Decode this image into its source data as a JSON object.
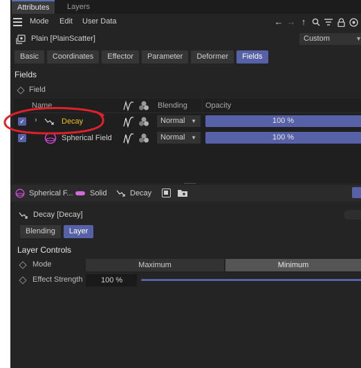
{
  "tabs": {
    "attributes": "Attributes",
    "layers": "Layers"
  },
  "menu": {
    "mode": "Mode",
    "edit": "Edit",
    "user_data": "User Data"
  },
  "object": {
    "title": "Plain [PlainScatter]",
    "preset": "Custom"
  },
  "prop_tabs": [
    "Basic",
    "Coordinates",
    "Effector",
    "Parameter",
    "Deformer",
    "Fields"
  ],
  "fields_section": {
    "title": "Fields",
    "field_label": "Field"
  },
  "list_header": {
    "name": "Name",
    "blending": "Blending",
    "opacity": "Opacity"
  },
  "rows": [
    {
      "name": "Decay",
      "blending": "Normal",
      "opacity": "100 %"
    },
    {
      "name": "Spherical Field",
      "blending": "Normal",
      "opacity": "100 %"
    }
  ],
  "lower_tabs": {
    "spherical": "Spherical F...",
    "solid": "Solid",
    "decay": "Decay"
  },
  "layer_title": "Decay [Decay]",
  "sub_tabs": {
    "blending": "Blending",
    "layer": "Layer"
  },
  "layer_controls": {
    "title": "Layer Controls",
    "mode_label": "Mode",
    "mode_max": "Maximum",
    "mode_min": "Minimum",
    "strength_label": "Effect Strength",
    "strength_value": "100 %"
  },
  "colors": {
    "accent": "#5661a8",
    "highlight_text": "#f0c419",
    "annotation": "#e0202a"
  }
}
